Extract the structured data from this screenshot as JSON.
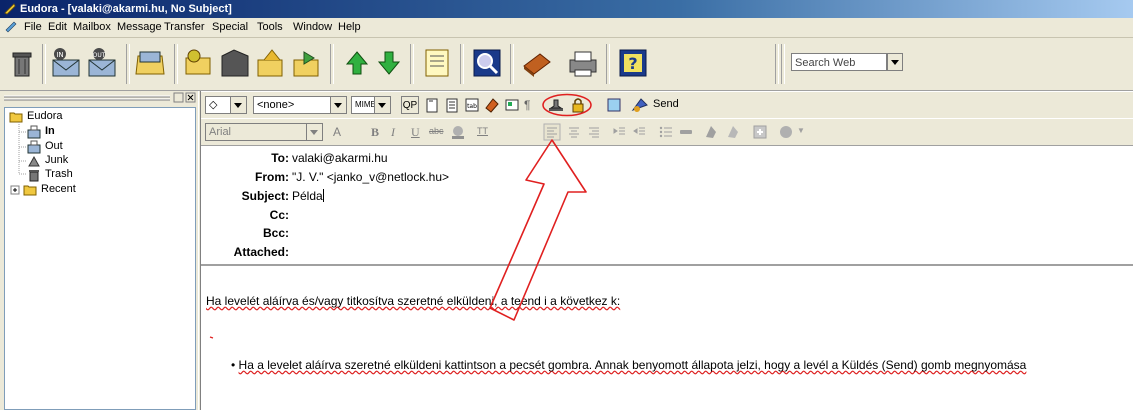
{
  "window": {
    "title": "Eudora - [valaki@akarmi.hu, No Subject]"
  },
  "menu": [
    "File",
    "Edit",
    "Mailbox",
    "Message",
    "Transfer",
    "Special",
    "Tools",
    "Window",
    "Help"
  ],
  "toolbar": {
    "search_text": "Search Web"
  },
  "tree": {
    "root": "Eudora",
    "items": [
      "In",
      "Out",
      "Junk",
      "Trash",
      "Recent"
    ]
  },
  "compose_toolbar": {
    "priority_value": "<none>",
    "mime_value": "MIME",
    "qp_label": "QP",
    "send_label": "Send"
  },
  "format_toolbar": {
    "font_value": "Arial",
    "size_label": "A",
    "bold": "B",
    "italic": "I",
    "underline": "U",
    "strike": "abc",
    "tt": "TT"
  },
  "header": {
    "to_label": "To:",
    "to_value": "valaki@akarmi.hu",
    "from_label": "From:",
    "from_value": "\"J. V.\" <janko_v@netlock.hu>",
    "subject_label": "Subject:",
    "subject_value": "Példa",
    "cc_label": "Cc:",
    "bcc_label": "Bcc:",
    "attached_label": "Attached:"
  },
  "body": {
    "line1": "Ha levelét aláírva és/vagy titkosítva szeretné elküldeni, a teend i a következ k:",
    "bullet": "•",
    "line2": "Ha a levelet aláírva szeretné elküldeni kattintson a pecsét gombra. Annak benyomott állapota jelzi, hogy a levél a Küldés (Send) gomb megnyomása"
  },
  "annotation": {
    "color": "#e02020"
  }
}
